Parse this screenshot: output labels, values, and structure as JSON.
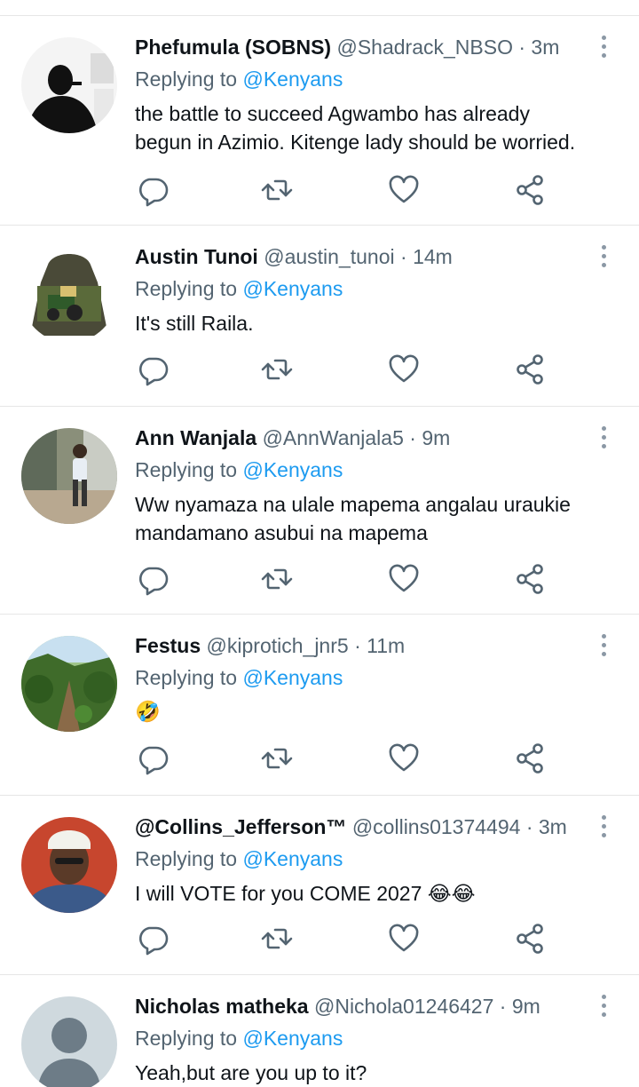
{
  "colors": {
    "name": "#0f1419",
    "secondary": "#536471",
    "mention": "#1d9bf0",
    "icon": "#536471",
    "divider": "#e6e6e6"
  },
  "tweets": [
    {
      "name": "Phefumula (SOBNS)",
      "handle": "@Shadrack_NBSO",
      "dot": "·",
      "time": "3m",
      "replying_lead": "Replying to ",
      "replying_mention": "@Kenyans",
      "body": "the battle to succeed Agwambo has already\nbegun in Azimio. Kitenge lady should be worried.",
      "avatar_icon": "person-silhouette-avatar"
    },
    {
      "name": "Austin Tunoi",
      "handle": "@austin_tunoi",
      "dot": "·",
      "time": "14m",
      "replying_lead": "Replying to ",
      "replying_mention": "@Kenyans",
      "body": "It's still Raila.",
      "avatar_icon": "hoodie-avatar"
    },
    {
      "name": "Ann Wanjala",
      "handle": "@AnnWanjala5",
      "dot": "·",
      "time": "9m",
      "replying_lead": "Replying to ",
      "replying_mention": "@Kenyans",
      "body": "Ww nyamaza na ulale mapema angalau uraukie\nmandamano asubui na mapema",
      "avatar_icon": "child-avatar"
    },
    {
      "name": "Festus",
      "handle": "@kiprotich_jnr5",
      "dot": "·",
      "time": "11m",
      "replying_lead": "Replying to ",
      "replying_mention": "@Kenyans",
      "body": "🤣",
      "avatar_icon": "farm-avatar"
    },
    {
      "name": "@Collins_Jefferson™",
      "handle": "@collins01374494",
      "dot": "·",
      "time": "3m",
      "replying_lead": "Replying to ",
      "replying_mention": "@Kenyans",
      "body": "I will VOTE for you COME 2027 😂😂",
      "avatar_icon": "man-with-cap-avatar"
    },
    {
      "name": "Nicholas matheka",
      "handle": "@Nichola01246427",
      "dot": "·",
      "time": "9m",
      "replying_lead": "Replying to ",
      "replying_mention": "@Kenyans",
      "body": "Yeah,but are you up to it?",
      "avatar_icon": "default-profile-avatar"
    }
  ],
  "action_icons": [
    "reply-icon",
    "retweet-icon",
    "like-icon",
    "share-icon"
  ],
  "more_icon": "more-options-icon"
}
